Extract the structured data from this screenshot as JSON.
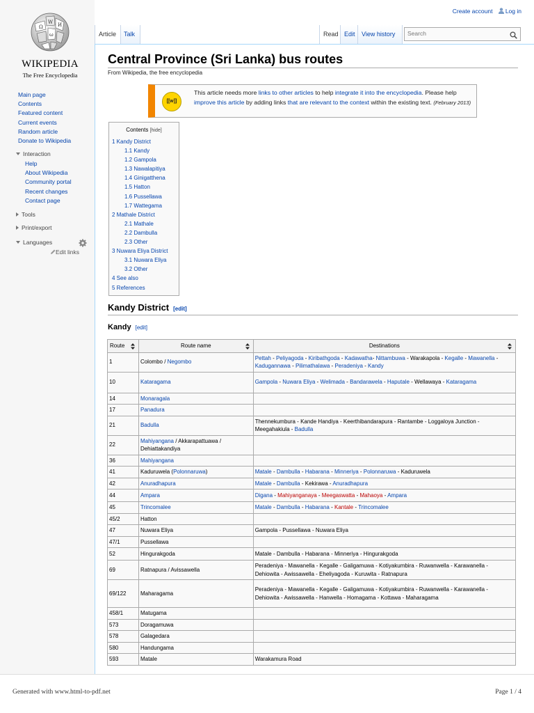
{
  "logo": {
    "wordmark": "WIKIPEDIA",
    "tagline": "The Free Encyclopedia"
  },
  "nav": [
    "Main page",
    "Contents",
    "Featured content",
    "Current events",
    "Random article",
    "Donate to Wikipedia"
  ],
  "interaction": {
    "heading": "Interaction",
    "items": [
      "Help",
      "About Wikipedia",
      "Community portal",
      "Recent changes",
      "Contact page"
    ]
  },
  "tools": "Tools",
  "print_export": "Print/export",
  "languages": "Languages",
  "edit_links": "Edit links",
  "personal": {
    "create_account": "Create account",
    "log_in": "Log in"
  },
  "tabs": {
    "article": "Article",
    "talk": "Talk",
    "read": "Read",
    "edit": "Edit",
    "view_history": "View history"
  },
  "search": {
    "placeholder": "Search"
  },
  "page": {
    "title": "Central Province (Sri Lanka) bus routes",
    "tagline": "From Wikipedia, the free encyclopedia"
  },
  "ambox": {
    "icon": "[[w]]",
    "t1": "This article needs more ",
    "l1": "links to other articles",
    "t2": " to help ",
    "l2": "integrate it into the encyclopedia",
    "t3": ". Please help ",
    "l3": "improve this article",
    "t4": " by adding links ",
    "l4": "that are relevant to the context",
    "t5": " within the existing text. ",
    "date": "(February 2013)"
  },
  "toc": {
    "title": "Contents",
    "hide": "[hide]",
    "items": [
      {
        "text": "1 Kandy District",
        "level": 1
      },
      {
        "text": "1.1 Kandy",
        "level": 2
      },
      {
        "text": "1.2 Gampola",
        "level": 2
      },
      {
        "text": "1.3 Nawalapitiya",
        "level": 2
      },
      {
        "text": "1.4 Ginigatthena",
        "level": 2
      },
      {
        "text": "1.5 Hatton",
        "level": 2
      },
      {
        "text": "1.6 Pussellawa",
        "level": 2
      },
      {
        "text": "1.7 Wattegama",
        "level": 2
      },
      {
        "text": "2 Mathale District",
        "level": 1
      },
      {
        "text": "2.1 Mathale",
        "level": 2
      },
      {
        "text": "2.2 Dambulla",
        "level": 2
      },
      {
        "text": "2.3 Other",
        "level": 2
      },
      {
        "text": "3 Nuwara Eliya District",
        "level": 1
      },
      {
        "text": "3.1 Nuwara Eliya",
        "level": 2
      },
      {
        "text": "3.2 Other",
        "level": 2
      },
      {
        "text": "4 See also",
        "level": 1
      },
      {
        "text": "5 References",
        "level": 1
      }
    ]
  },
  "section": {
    "heading": "Kandy District",
    "edit": "[edit]"
  },
  "subsection": {
    "heading": "Kandy",
    "edit": "[edit]"
  },
  "table": {
    "headers": [
      "Route",
      "Route name",
      "Destinations"
    ],
    "rows": [
      {
        "route": "1",
        "h": 26,
        "name": [
          [
            "Colombo / ",
            "t"
          ],
          [
            "Negombo",
            "l"
          ]
        ],
        "dest": [
          [
            "Pettah",
            "l"
          ],
          [
            " - ",
            "t"
          ],
          [
            "Peliyagoda",
            "l"
          ],
          [
            " - ",
            "t"
          ],
          [
            "Kiribathgoda",
            "l"
          ],
          [
            " - ",
            "t"
          ],
          [
            "Kadawatha",
            "l"
          ],
          [
            "- ",
            "t"
          ],
          [
            "Nittambuwa",
            "l"
          ],
          [
            " - Warakapola - ",
            "t"
          ],
          [
            "Kegalle",
            "l"
          ],
          [
            " - ",
            "t"
          ],
          [
            "Mawanella",
            "l"
          ],
          [
            " - ",
            "t"
          ],
          [
            "Kadugannawa",
            "l"
          ],
          [
            " - ",
            "t"
          ],
          [
            "Pilimathalawa",
            "l"
          ],
          [
            " - ",
            "t"
          ],
          [
            "Peradeniya",
            "l"
          ],
          [
            " - ",
            "t"
          ],
          [
            "Kandy",
            "l"
          ]
        ]
      },
      {
        "route": "10",
        "h": 30,
        "name": [
          [
            "Kataragama",
            "l"
          ]
        ],
        "dest": [
          [
            "Gampola",
            "l"
          ],
          [
            " - ",
            "t"
          ],
          [
            "Nuwara Eliya",
            "l"
          ],
          [
            " - ",
            "t"
          ],
          [
            "Welimada",
            "l"
          ],
          [
            " - ",
            "t"
          ],
          [
            "Bandarawela",
            "l"
          ],
          [
            " - ",
            "t"
          ],
          [
            "Haputale",
            "l"
          ],
          [
            " - Wellawaya - ",
            "t"
          ],
          [
            "Kataragama",
            "l"
          ]
        ]
      },
      {
        "route": "14",
        "h": 16,
        "name": [
          [
            "Monaragala",
            "l"
          ]
        ],
        "dest": []
      },
      {
        "route": "17",
        "h": 16,
        "name": [
          [
            "Panadura",
            "l"
          ]
        ],
        "dest": []
      },
      {
        "route": "21",
        "h": 28,
        "name": [
          [
            "Badulla",
            "l"
          ]
        ],
        "dest": [
          [
            "Thennekumbura - Kande Handiya - Keerthibandarapura - Rantambe - Loggaloya Junction - Meegahakiula - ",
            "t"
          ],
          [
            "Badulla",
            "l"
          ]
        ]
      },
      {
        "route": "22",
        "h": 28,
        "name": [
          [
            "Mahiyangana",
            "l"
          ],
          [
            " / Akkarapattuawa / Dehiattakandiya",
            "t"
          ]
        ],
        "dest": []
      },
      {
        "route": "36",
        "h": 16,
        "name": [
          [
            "Mahiyangana",
            "l"
          ]
        ],
        "dest": []
      },
      {
        "route": "41",
        "h": 16,
        "name": [
          [
            "Kaduruwela (",
            "t"
          ],
          [
            "Polonnaruwa",
            "l"
          ],
          [
            ")",
            "t"
          ]
        ],
        "dest": [
          [
            "Matale",
            "l"
          ],
          [
            " - ",
            "t"
          ],
          [
            "Dambulla",
            "l"
          ],
          [
            " - ",
            "t"
          ],
          [
            "Habarana",
            "l"
          ],
          [
            " - ",
            "t"
          ],
          [
            "Minneriya",
            "l"
          ],
          [
            " - ",
            "t"
          ],
          [
            "Polonnaruwa",
            "l"
          ],
          [
            " - Kaduruwela",
            "t"
          ]
        ]
      },
      {
        "route": "42",
        "h": 16,
        "name": [
          [
            "Anuradhapura",
            "l"
          ]
        ],
        "dest": [
          [
            "Matale",
            "l"
          ],
          [
            " - ",
            "t"
          ],
          [
            "Dambulla",
            "l"
          ],
          [
            " - Kekirawa - ",
            "t"
          ],
          [
            "Anuradhapura",
            "l"
          ]
        ]
      },
      {
        "route": "44",
        "h": 18,
        "name": [
          [
            "Ampara",
            "l"
          ]
        ],
        "dest": [
          [
            "Digana",
            "l"
          ],
          [
            " - ",
            "t"
          ],
          [
            "Mahiyanganaya",
            "r"
          ],
          [
            " - ",
            "t"
          ],
          [
            "Meegaswatta",
            "r"
          ],
          [
            " - ",
            "t"
          ],
          [
            "Mahaoya",
            "r"
          ],
          [
            " - ",
            "t"
          ],
          [
            "Ampara",
            "l"
          ]
        ]
      },
      {
        "route": "45",
        "h": 16,
        "name": [
          [
            "Trincomalee",
            "l"
          ]
        ],
        "dest": [
          [
            "Matale",
            "l"
          ],
          [
            " - ",
            "t"
          ],
          [
            "Dambulla",
            "l"
          ],
          [
            " - ",
            "t"
          ],
          [
            "Habarana",
            "l"
          ],
          [
            " - ",
            "t"
          ],
          [
            "Kantale",
            "r"
          ],
          [
            " - ",
            "t"
          ],
          [
            "Trincomalee",
            "l"
          ]
        ]
      },
      {
        "route": "45/2",
        "h": 16,
        "name": [
          [
            "Hatton",
            "t"
          ]
        ],
        "dest": []
      },
      {
        "route": "47",
        "h": 16,
        "name": [
          [
            "Nuwara Eliya",
            "t"
          ]
        ],
        "dest": [
          [
            "Gampola - Pussellawa - Nuwara Eliya",
            "t"
          ]
        ]
      },
      {
        "route": "47/1",
        "h": 16,
        "name": [
          [
            "Pussellawa",
            "t"
          ]
        ],
        "dest": []
      },
      {
        "route": "52",
        "h": 18,
        "name": [
          [
            "Hingurakgoda",
            "t"
          ]
        ],
        "dest": [
          [
            "Matale - Dambulla - Habarana - Minneriya - Hingurakgoda",
            "t"
          ]
        ]
      },
      {
        "route": "69",
        "h": 28,
        "name": [
          [
            "Ratnapura / Avissawella",
            "t"
          ]
        ],
        "dest": [
          [
            "Peradeniya - Mawanella - Kegalle - Galigamuwa - Kotiyakumbira - Ruwanwella - Karawanella - Dehiowita - Awissawella - Eheliyagoda - Kuruwita - Ratnapura",
            "t"
          ]
        ]
      },
      {
        "route": "69/122",
        "h": 40,
        "name": [
          [
            "Maharagama",
            "t"
          ]
        ],
        "dest": [
          [
            "Peradeniya - Mawanella - Kegalle - Galigamuwa - Kotiyakumbira - Ruwanwella - Karawanella - Dehiowita - Awissawella - Hanwella - Homagama - Kottawa - Maharagama",
            "t"
          ]
        ]
      },
      {
        "route": "458/1",
        "h": 16,
        "name": [
          [
            "Matugama",
            "t"
          ]
        ],
        "dest": []
      },
      {
        "route": "573",
        "h": 16,
        "name": [
          [
            "Doragamuwa",
            "t"
          ]
        ],
        "dest": []
      },
      {
        "route": "578",
        "h": 16,
        "name": [
          [
            "Galagedara",
            "t"
          ]
        ],
        "dest": []
      },
      {
        "route": "580",
        "h": 16,
        "name": [
          [
            "Handungama",
            "t"
          ]
        ],
        "dest": []
      },
      {
        "route": "593",
        "h": 16,
        "name": [
          [
            "Matale",
            "t"
          ]
        ],
        "dest": [
          [
            "Warakamura Road",
            "t"
          ]
        ]
      }
    ]
  },
  "footer": {
    "generated": "Generated with www.html-to-pdf.net",
    "page": "Page 1 / 4"
  },
  "colors": {
    "link": "#0645ad",
    "redlink": "#ba0000",
    "ambox_bar": "#f28500",
    "border_blue": "#a7d7f9"
  }
}
